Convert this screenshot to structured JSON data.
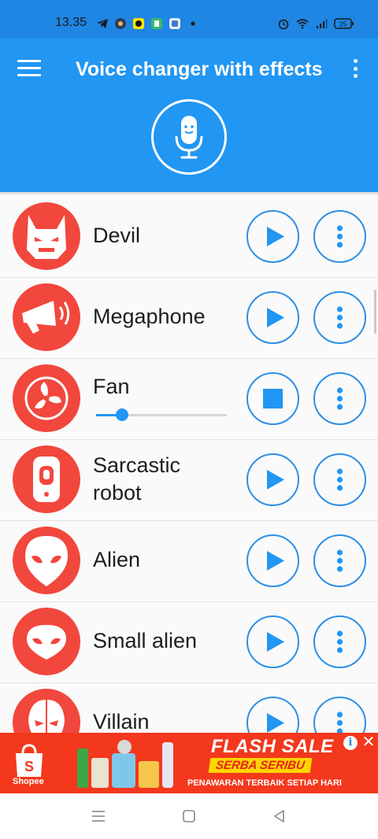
{
  "status_bar": {
    "time": "13.35",
    "left_icons": [
      "telegram-icon",
      "app-notification-icon",
      "app-notification-icon",
      "app-notification-icon",
      "app-notification-icon",
      "dot-icon"
    ],
    "right_icons": [
      "alarm-icon",
      "wifi-icon",
      "signal-icon",
      "battery-icon"
    ],
    "battery": "25"
  },
  "app_bar": {
    "title": "Voice changer with effects",
    "menu_icon": "hamburger-icon",
    "overflow_icon": "more-vertical-icon",
    "record_icon": "microphone-icon"
  },
  "effects": [
    {
      "label": "Devil",
      "icon": "devil-icon",
      "state": "play"
    },
    {
      "label": "Megaphone",
      "icon": "megaphone-icon",
      "state": "play"
    },
    {
      "label": "Fan",
      "icon": "fan-icon",
      "state": "stop",
      "slider_value": 0.2
    },
    {
      "label": "Sarcastic robot",
      "icon": "robot-icon",
      "state": "play"
    },
    {
      "label": "Alien",
      "icon": "alien-icon",
      "state": "play"
    },
    {
      "label": "Small alien",
      "icon": "small-alien-icon",
      "state": "play"
    },
    {
      "label": "Villain",
      "icon": "villain-icon",
      "state": "play"
    }
  ],
  "ad": {
    "brand": "Shopee",
    "headline": "FLASH SALE",
    "tagline": "SERBA SERIBU",
    "subtext": "PENAWARAN TERBAIK SETIAP HARI"
  },
  "colors": {
    "primary": "#2196f3",
    "status_bar": "#1f86e3",
    "avatar": "#f2473d",
    "button_border": "#2d8fe6",
    "ad_background": "#f3381d"
  }
}
